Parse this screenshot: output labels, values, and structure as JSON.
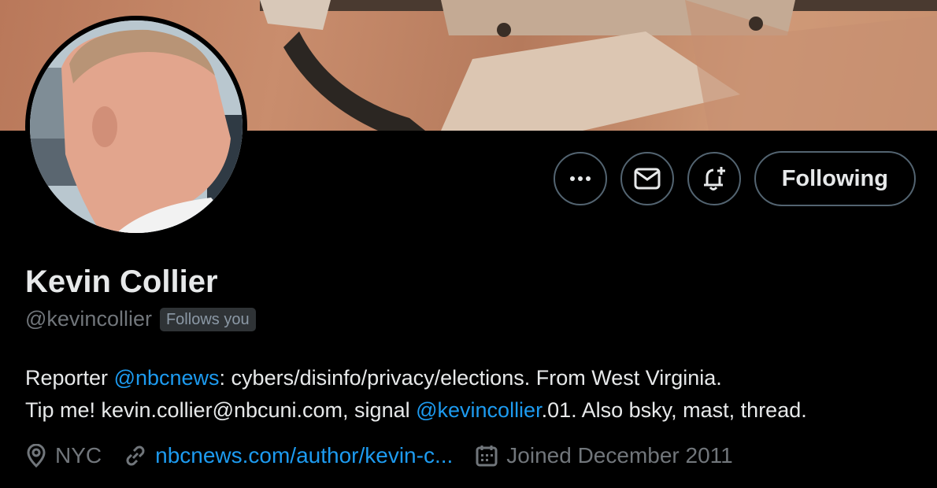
{
  "profile": {
    "name": "Kevin Collier",
    "handle": "@kevincollier",
    "follows_you": "Follows you"
  },
  "actions": {
    "more": "more-icon",
    "message": "mail-icon",
    "notify": "bell-plus-icon",
    "following_label": "Following"
  },
  "bio": {
    "line1_a": "Reporter ",
    "line1_link": "@nbcnews",
    "line1_b": ": cybers/disinfo/privacy/elections. From West Virginia.",
    "line2_a": "Tip me! kevin.collier@nbcuni.com, signal ",
    "line2_link": "@kevincollier",
    "line2_b": ".01. Also bsky, mast, thread."
  },
  "meta": {
    "location": "NYC",
    "website": "nbcnews.com/author/kevin-c...",
    "joined": "Joined December 2011"
  },
  "colors": {
    "background": "#000000",
    "text": "#e7e9ea",
    "secondary": "#71767b",
    "link": "#1d9bf0",
    "border": "#536471"
  }
}
